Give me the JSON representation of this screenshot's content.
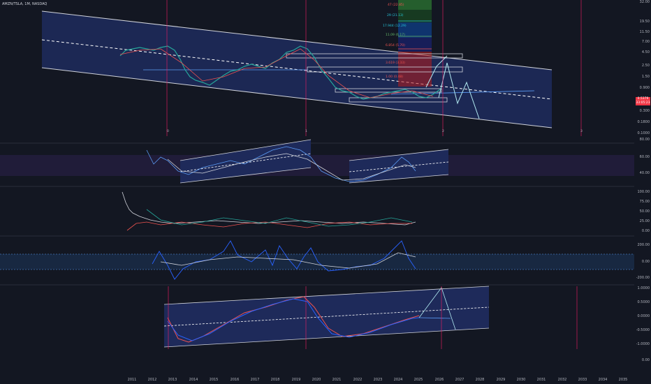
{
  "header": {
    "symbol": "AMZN/TSLA, 1M, NASDAQ"
  },
  "price_badge": {
    "value": "0.5379",
    "sub": "33:05:23"
  },
  "panes": [
    {
      "name": "price",
      "ticks": [
        "32.00",
        "19.50",
        "11.50",
        "7.00",
        "4.50",
        "2.50",
        "1.50",
        "0.900",
        "0.500",
        "0.300",
        "0.1800",
        "0.1000"
      ]
    },
    {
      "name": "oscillator-1",
      "ticks": [
        "80.00",
        "60.00",
        "40.00"
      ]
    },
    {
      "name": "oscillator-2",
      "ticks": [
        "100.00",
        "75.00",
        "50.00",
        "25.00",
        "0.00"
      ]
    },
    {
      "name": "oscillator-3",
      "ticks": [
        "200.00",
        "0.00",
        "-200.00"
      ]
    },
    {
      "name": "oscillator-4",
      "ticks": [
        "1.0000",
        "0.5000",
        "0.0000",
        "-0.5000",
        "-1.0000",
        "0.00"
      ]
    }
  ],
  "fib_labels": [
    "47 (22.85)",
    "29 (21.13)",
    "17.944 (12.29)",
    "11.09 (6.17)",
    "6.854 (5.70)",
    "3.619 (3.33)",
    "1.00 (0.48)"
  ],
  "cycle_labels": [
    "0",
    "1",
    "2",
    "3"
  ],
  "xaxis": [
    "2011",
    "2012",
    "2013",
    "2014",
    "2015",
    "2016",
    "2017",
    "2018",
    "2019",
    "2020",
    "2021",
    "2022",
    "2023",
    "2024",
    "2025",
    "2026",
    "2027",
    "2028",
    "2029",
    "2030",
    "2031",
    "2032",
    "2033",
    "2034",
    "2035"
  ],
  "colors": {
    "background": "#131722",
    "channel_fill": "#1e2a5a",
    "accent_red": "#f23645",
    "grid_purple": "#9c27b0"
  }
}
